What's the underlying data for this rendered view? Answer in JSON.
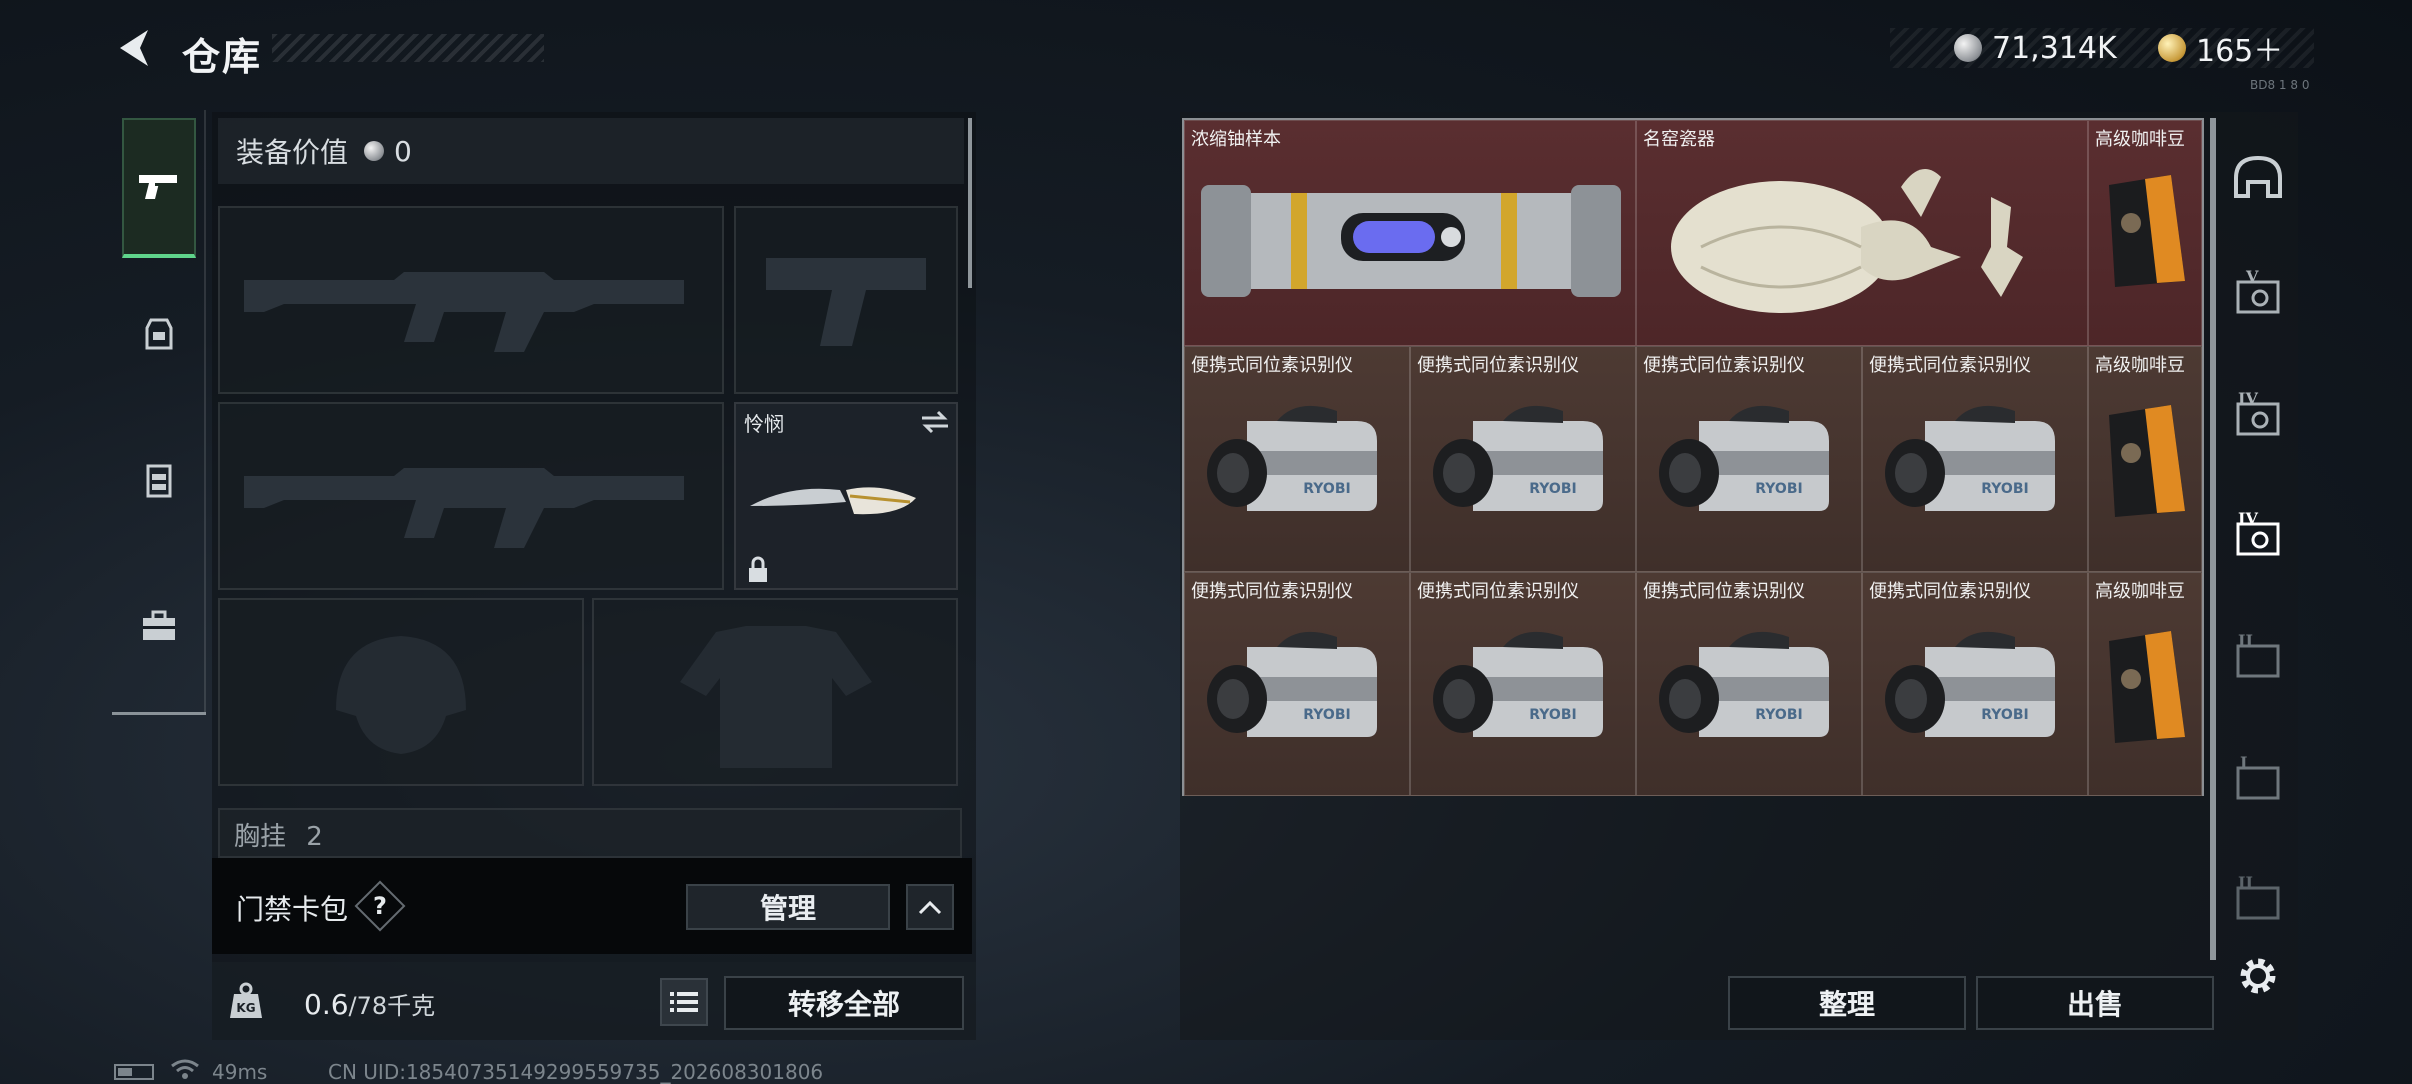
{
  "header": {
    "title": "仓库",
    "currency_silver": "71,314K",
    "currency_gold": "165＋",
    "corner_tag": "BD8 1 8 0"
  },
  "tabs": [
    {
      "name": "weapon-tab",
      "icon": "pistol-icon",
      "active": true
    },
    {
      "name": "gear-tab",
      "icon": "backpack-icon",
      "active": false
    },
    {
      "name": "vest-tab",
      "icon": "chest-rig-icon",
      "active": false
    },
    {
      "name": "medkit-tab",
      "icon": "toolbox-icon",
      "active": false
    }
  ],
  "equipment": {
    "value_label": "装备价值",
    "value": "0",
    "melee_label": "怜悯",
    "chest_label": "胸挂",
    "chest_value": "2"
  },
  "card_pack": {
    "label": "门禁卡包",
    "help": "?",
    "manage": "管理"
  },
  "weight": {
    "current": "0.6",
    "max": "/78千克",
    "transfer_all": "转移全部"
  },
  "inventory": {
    "items": {
      "uranium": "浓缩铀样本",
      "porcelain": "名窑瓷器",
      "coffee": "高级咖啡豆",
      "isotope": "便携式同位素识别仪"
    },
    "sort": "整理",
    "sell": "出售"
  },
  "categories": [
    "helmet-icon",
    "case-v-icon",
    "case-iv-icon",
    "case-iv-active-icon",
    "case-ii-icon",
    "case-i-icon",
    "case-ii-small-icon"
  ],
  "status": {
    "ping": "49ms",
    "uid": "CN UID:18540735149299559735_202608301806"
  },
  "colors": {
    "accent_green": "#5fd48b",
    "legendary_red": "#5a2e30",
    "epic_brown": "#4d3a33"
  }
}
